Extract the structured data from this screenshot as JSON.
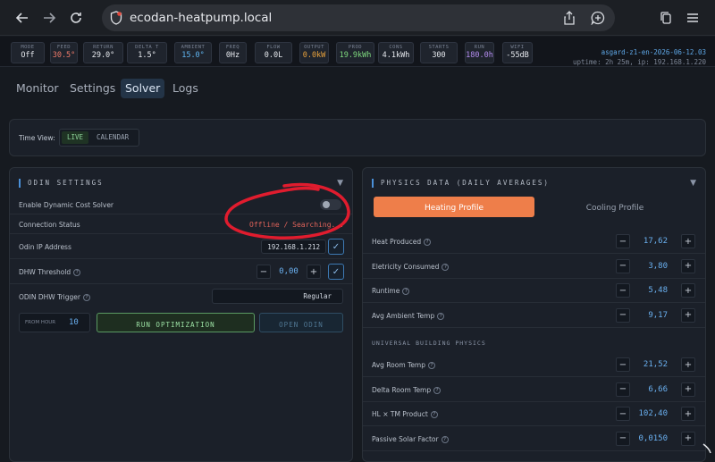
{
  "browser": {
    "url": "ecodan-heatpump.local"
  },
  "stats": [
    {
      "label": "MODE",
      "value": "Off",
      "color": "#e6e9ee"
    },
    {
      "label": "FEED",
      "value": "30.5°",
      "color": "#f07b6a"
    },
    {
      "label": "RETURN",
      "value": "29.0°",
      "color": "#e6e9ee"
    },
    {
      "label": "DELTA T",
      "value": "1.5°",
      "color": "#e6e9ee"
    },
    {
      "label": "AMBIENT",
      "value": "15.0°",
      "color": "#5fb4f0"
    },
    {
      "label": "FREQ",
      "value": "0Hz",
      "color": "#e6e9ee"
    },
    {
      "label": "FLOW",
      "value": "0.0L",
      "color": "#e6e9ee"
    },
    {
      "label": "OUTPUT",
      "value": "0.0kW",
      "color": "#e8a23c"
    },
    {
      "label": "PROD",
      "value": "19.9kWh",
      "color": "#7ed87e"
    },
    {
      "label": "CONS",
      "value": "4.1kWh",
      "color": "#e6e9ee"
    },
    {
      "label": "STARTS",
      "value": "300",
      "color": "#e6e9ee"
    },
    {
      "label": "RUN",
      "value": "180.0h",
      "color": "#b48cf0"
    },
    {
      "label": "WIFI",
      "value": "-55dB",
      "color": "#e6e9ee"
    }
  ],
  "system": {
    "device": "asgard-z1-en-2026-06-12.03",
    "uptime": "uptime: 2h 25m, ip: 192.168.1.220"
  },
  "tabs": [
    "Monitor",
    "Settings",
    "Solver",
    "Logs"
  ],
  "timeview": {
    "label": "Time View:",
    "options": [
      "LIVE",
      "CALENDAR"
    ]
  },
  "odin": {
    "title": "ODIN SETTINGS",
    "caret": "▼",
    "dynamic_label": "Enable Dynamic Cost Solver",
    "status_label": "Connection Status",
    "status_value": "Offline / Searching...",
    "ip_label": "Odin IP Address",
    "ip_value": "192.168.1.212",
    "dhw_label": "DHW Threshold",
    "dhw_value": "0,00",
    "trigger_label": "ODIN DHW Trigger",
    "trigger_value": "Regular",
    "from_hour_label": "FROM HOUR",
    "from_hour_value": "10",
    "run_label": "RUN OPTIMIZATION",
    "open_label": "OPEN ODIN"
  },
  "physics": {
    "title": "PHYSICS DATA (DAILY AVERAGES)",
    "caret": "▼",
    "profile_heating": "Heating Profile",
    "profile_cooling": "Cooling Profile",
    "section_label": "UNIVERSAL BUILDING PHYSICS",
    "rows1": [
      {
        "label": "Heat Produced",
        "value": "17,62"
      },
      {
        "label": "Eletricity Consumed",
        "value": "3,80"
      },
      {
        "label": "Runtime",
        "value": "5,48"
      },
      {
        "label": "Avg Ambient Temp",
        "value": "9,17"
      }
    ],
    "rows2": [
      {
        "label": "Avg Room Temp",
        "value": "21,52"
      },
      {
        "label": "Delta Room Temp",
        "value": "6,66"
      },
      {
        "label": "HL × TM Product",
        "value": "102,40"
      },
      {
        "label": "Passive Solar Factor",
        "value": "0,0150"
      }
    ]
  }
}
